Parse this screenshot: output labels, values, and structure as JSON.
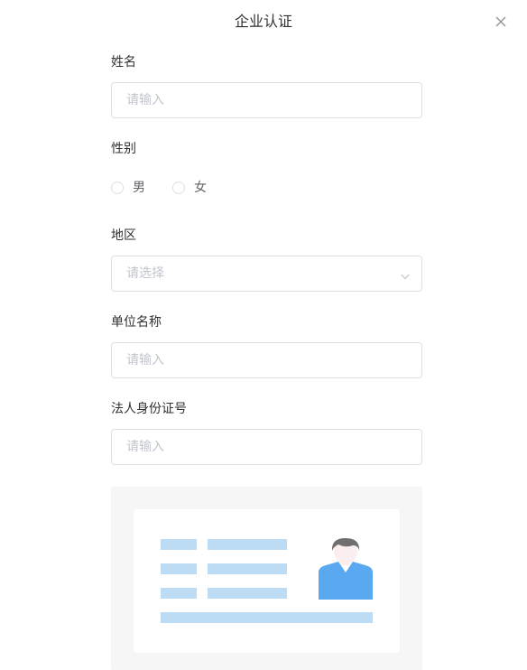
{
  "dialog": {
    "title": "企业认证",
    "close_icon": "close-icon"
  },
  "form": {
    "name": {
      "label": "姓名",
      "placeholder": "请输入"
    },
    "gender": {
      "label": "性别",
      "options": [
        {
          "label": "男",
          "checked": false
        },
        {
          "label": "女",
          "checked": false
        }
      ]
    },
    "region": {
      "label": "地区",
      "placeholder": "请选择",
      "icon": "chevron-down-icon"
    },
    "company": {
      "label": "单位名称",
      "placeholder": "请输入"
    },
    "legal_id": {
      "label": "法人身份证号",
      "placeholder": "请输入"
    }
  },
  "id_card_illustration": {
    "icon": "id-card-icon",
    "colors": {
      "panel_bg": "#f6f6f6",
      "card_bg": "#ffffff",
      "line": "#bcdcf6",
      "hair": "#6f6f6f",
      "face": "#fbeeee",
      "shirt": "#5aa9f0"
    }
  }
}
